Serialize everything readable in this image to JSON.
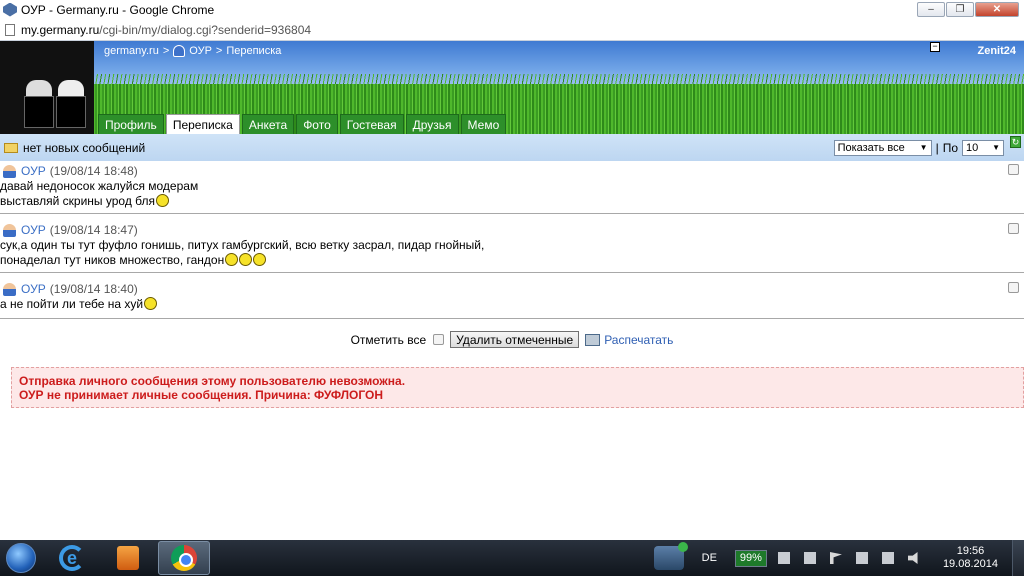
{
  "window": {
    "title": "ОУР - Germany.ru - Google Chrome",
    "minimize_label": "–",
    "maximize_label": "❐",
    "close_label": "✕"
  },
  "address": {
    "host": "my.germany.ru",
    "path": "/cgi-bin/my/dialog.cgi?senderid=936804"
  },
  "header": {
    "breadcrumb_site": "germany.ru",
    "breadcrumb_sep1": ">",
    "breadcrumb_user": "ОУР",
    "breadcrumb_sep2": ">",
    "breadcrumb_page": "Переписка",
    "username": "Zenit24",
    "collapse_label": "−",
    "tabs": [
      {
        "label": "Профиль"
      },
      {
        "label": "Переписка"
      },
      {
        "label": "Анкета"
      },
      {
        "label": "Фото"
      },
      {
        "label": "Гостевая"
      },
      {
        "label": "Друзья"
      },
      {
        "label": "Мемо"
      }
    ]
  },
  "toolbar": {
    "status": "нет новых сообщений",
    "show_select": "Показать все",
    "separator": "|",
    "per_page_label": "По",
    "per_page_select": "10",
    "refresh_icon": "refresh-icon",
    "refresh_label": "↻"
  },
  "messages": [
    {
      "author": "ОУР",
      "timestamp": "(19/08/14 18:48)",
      "line1": "давай недоносок жалуйся модерам",
      "line2": "выставляй скрины урод бля"
    },
    {
      "author": "ОУР",
      "timestamp": "(19/08/14 18:47)",
      "line1": "сук,а один ты тут фуфло гонишь, питух гамбургский, всю ветку засрал, пидар гнойный,",
      "line2": "понаделал тут ников множество, гандон"
    },
    {
      "author": "ОУР",
      "timestamp": "(19/08/14 18:40)",
      "line1": "а не пойти ли тебе на хуй"
    }
  ],
  "actions": {
    "select_all": "Отметить все",
    "delete_button": "Удалить отмеченные",
    "print_link": "Распечатать"
  },
  "notice": {
    "line1": "Отправка личного сообщения этому пользователю невозможна.",
    "line2": "ОУР не принимает личные сообщения. Причина: ФУФЛОГОН"
  },
  "taskbar": {
    "language": "DE",
    "battery": "99%",
    "time": "19:56",
    "date": "19.08.2014"
  }
}
